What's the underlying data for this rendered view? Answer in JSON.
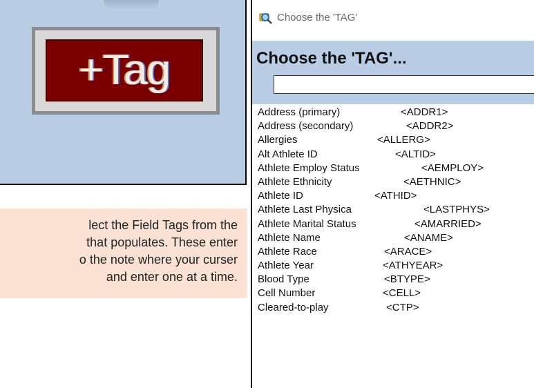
{
  "tag_button": {
    "label": "+Tag"
  },
  "instruction": {
    "lines": [
      "lect the Field Tags from the",
      "that populates. These enter",
      "o the note where your curser",
      "and enter one at a time."
    ]
  },
  "dialog": {
    "window_title": "Choose the 'TAG'",
    "heading": "Choose the 'TAG'...",
    "search": {
      "value": "",
      "placeholder": ""
    },
    "items": [
      {
        "label": "Address (primary)",
        "code": "<ADDR1>"
      },
      {
        "label": "Address (secondary)",
        "code": "<ADDR2>"
      },
      {
        "label": "Allergies",
        "code": "<ALLERG>"
      },
      {
        "label": "Alt Athlete ID",
        "code": "<ALTID>"
      },
      {
        "label": "Athlete Employ Status",
        "code": "<AEMPLOY>"
      },
      {
        "label": "Athlete Ethnicity",
        "code": "<AETHNIC>"
      },
      {
        "label": "Athlete ID",
        "code": "<ATHID>"
      },
      {
        "label": "Athlete Last Physica",
        "code": "<LASTPHYS>"
      },
      {
        "label": "Athlete Marital Status",
        "code": "<AMARRIED>"
      },
      {
        "label": "Athlete Name",
        "code": "<ANAME>"
      },
      {
        "label": "Athlete Race",
        "code": "<ARACE>"
      },
      {
        "label": "Athlete Year",
        "code": "<ATHYEAR>"
      },
      {
        "label": "Blood Type",
        "code": "<BTYPE>"
      },
      {
        "label": "Cell Number",
        "code": "<CELL>"
      },
      {
        "label": "Cleared-to-play",
        "code": "<CTP>"
      }
    ]
  },
  "colors": {
    "panel_bg": "#b9cde4",
    "button_bg": "#7a0000",
    "note_bg": "#fbe2d4",
    "dialog_header_bg": "#b9cde4"
  },
  "icons": {
    "app_icon": "magnifier-tag-icon"
  }
}
